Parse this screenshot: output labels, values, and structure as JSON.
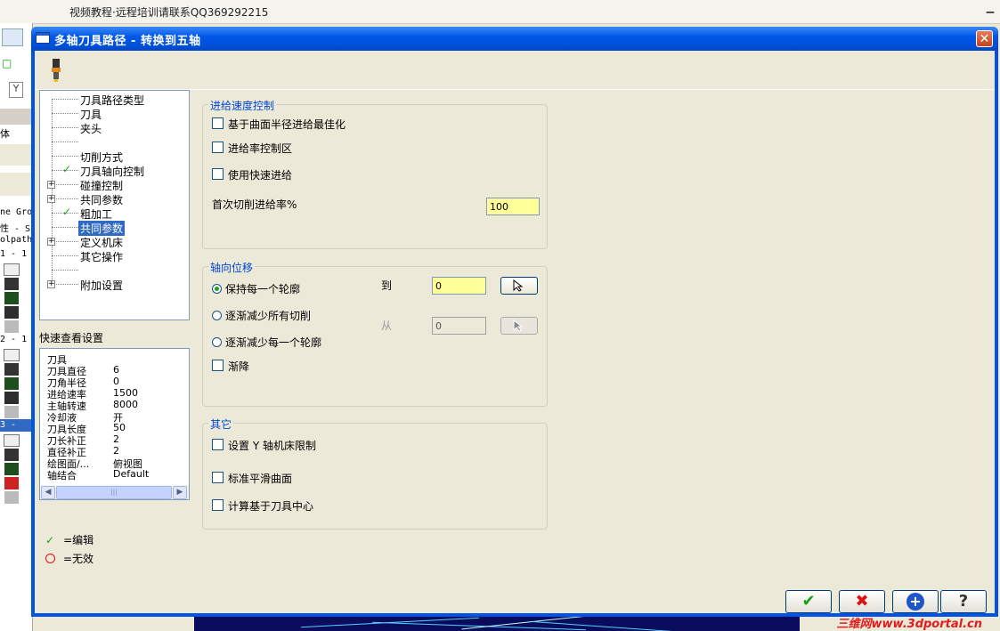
{
  "app": {
    "title": "视频教程·远程培训请联系QQ369292215",
    "minimize": "▁"
  },
  "background_panel": {
    "tool_y_label": "Y",
    "body_label": "体",
    "lines": [
      "ne Gro",
      "性 - S",
      "olpath",
      "1 - 1",
      "2 - 1",
      "3 -"
    ]
  },
  "dialog": {
    "title": "多轴刀具路径 - 转换到五轴",
    "close": "✕",
    "tree": {
      "items": [
        {
          "label": "刀具路径类型",
          "check": "",
          "expander": ""
        },
        {
          "label": "刀具",
          "check": "",
          "expander": ""
        },
        {
          "label": "夹头",
          "check": "",
          "expander": ""
        },
        {
          "label": "",
          "check": "",
          "expander": ""
        },
        {
          "label": "切削方式",
          "check": "",
          "expander": ""
        },
        {
          "label": "刀具轴向控制",
          "check": "✓",
          "expander": ""
        },
        {
          "label": "碰撞控制",
          "check": "",
          "expander": "+"
        },
        {
          "label": "共同参数",
          "check": "",
          "expander": "+"
        },
        {
          "label": "粗加工",
          "check": "✓",
          "expander": ""
        },
        {
          "label": "共同参数",
          "check": "",
          "expander": "",
          "selected": true
        },
        {
          "label": "定义机床",
          "check": "",
          "expander": "+"
        },
        {
          "label": "其它操作",
          "check": "",
          "expander": ""
        },
        {
          "label": "",
          "check": "",
          "expander": ""
        },
        {
          "label": "附加设置",
          "check": "",
          "expander": "+"
        }
      ]
    },
    "quick_view": {
      "label": "快速查看设置",
      "header": "刀具",
      "rows": [
        {
          "key": "刀具直径",
          "value": "6"
        },
        {
          "key": "刀角半径",
          "value": "0"
        },
        {
          "key": "进给速率",
          "value": "1500"
        },
        {
          "key": "主轴转速",
          "value": "8000"
        },
        {
          "key": "冷却液",
          "value": "开"
        },
        {
          "key": "刀具长度",
          "value": "50"
        },
        {
          "key": "刀长补正",
          "value": "2"
        },
        {
          "key": "直径补正",
          "value": "2"
        },
        {
          "key": "绘图面/...",
          "value": "俯视图"
        },
        {
          "key": "轴结合",
          "value": "Default"
        }
      ],
      "scroll_left": "◀",
      "scroll_right": "▶",
      "scroll_thumb": "|||"
    },
    "legend": {
      "edit_icon": "✓",
      "edit": "=编辑",
      "invalid": "=无效"
    },
    "feed_group": {
      "title": "进给速度控制",
      "optimize_by_radius": "基于曲面半径进给最佳化",
      "feed_rate_zone": "进给率控制区",
      "use_rapid_feed": "使用快速进给",
      "first_cut_label": "首次切削进给率%",
      "first_cut_value": "100"
    },
    "axial_group": {
      "title": "轴向位移",
      "keep_each_contour": "保持每一个轮廓",
      "reduce_all_cuts": "逐渐减少所有切削",
      "reduce_each_contour": "逐渐减少每一个轮廓",
      "taper": "渐降",
      "to_label": "到",
      "to_value": "0",
      "from_label": "从",
      "from_value": "0"
    },
    "other_group": {
      "title": "其它",
      "y_axis_limit": "设置 Y 轴机床限制",
      "standard_smooth": "标准平滑曲面",
      "tool_center": "计算基于刀具中心"
    },
    "buttons": {
      "ok": "✔",
      "cancel": "✖",
      "add": "+",
      "help": "?"
    }
  },
  "watermark": "三维网www.3dportal.cn"
}
